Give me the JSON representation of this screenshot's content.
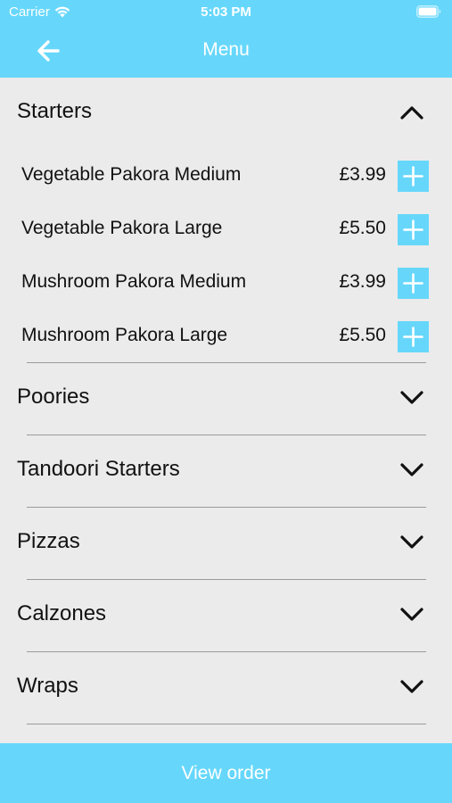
{
  "status_bar": {
    "carrier": "Carrier",
    "time": "5:03 PM"
  },
  "nav": {
    "title": "Menu",
    "back_icon": "arrow-left-icon"
  },
  "colors": {
    "accent": "#66d7fb",
    "background": "#ebebeb",
    "text": "#111111",
    "divider": "#9a9a9a"
  },
  "categories": [
    {
      "title": "Starters",
      "expanded": true,
      "icon": "chevron-up-icon",
      "items": [
        {
          "name": "Vegetable Pakora Medium",
          "price": "£3.99"
        },
        {
          "name": "Vegetable Pakora Large",
          "price": "£5.50"
        },
        {
          "name": "Mushroom Pakora Medium",
          "price": "£3.99"
        },
        {
          "name": "Mushroom Pakora Large",
          "price": "£5.50"
        }
      ]
    },
    {
      "title": "Poories",
      "expanded": false,
      "icon": "chevron-down-icon"
    },
    {
      "title": "Tandoori Starters",
      "expanded": false,
      "icon": "chevron-down-icon"
    },
    {
      "title": "Pizzas",
      "expanded": false,
      "icon": "chevron-down-icon"
    },
    {
      "title": "Calzones",
      "expanded": false,
      "icon": "chevron-down-icon"
    },
    {
      "title": "Wraps",
      "expanded": false,
      "icon": "chevron-down-icon"
    }
  ],
  "footer": {
    "view_order_label": "View order"
  }
}
